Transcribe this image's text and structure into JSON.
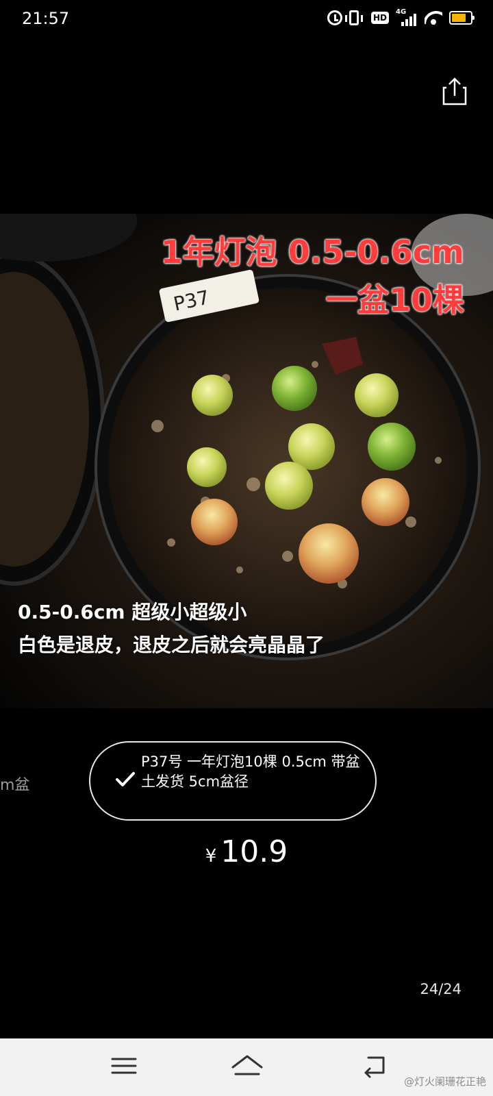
{
  "status_bar": {
    "time": "21:57",
    "hd_badge": "HD",
    "network": "4G",
    "battery_color": "#f5b400"
  },
  "toolbar": {
    "share_icon": "share-icon"
  },
  "photo": {
    "overlay_line1": "1年灯泡 0.5-0.6cm",
    "overlay_line2": "一盆10棵",
    "overlay_line3": "0.5-0.6cm  超级小超级小",
    "overlay_line4": "白色是退皮，退皮之后就会亮晶晶了",
    "pot_label": "P37"
  },
  "options": {
    "previous_partial": "m盆",
    "selected_label": "P37号 一年灯泡10棵 0.5cm 带盆土发货 5cm盆径"
  },
  "price": {
    "currency": "¥",
    "value": "10.9"
  },
  "pager": {
    "counter": "24/24"
  },
  "nav": {
    "menu_icon": "menu-icon",
    "home_icon": "home-icon",
    "back_icon": "back-icon",
    "watermark": "@灯火阑珊花正艳"
  }
}
